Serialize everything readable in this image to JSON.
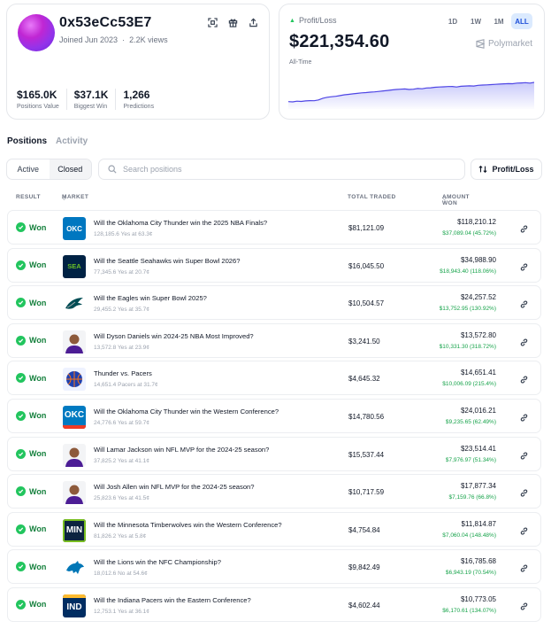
{
  "profile": {
    "username": "0x53eCc53E7",
    "joined": "Joined Jun 2023",
    "views": "2.2K views",
    "stats": [
      {
        "value": "$165.0K",
        "label": "Positions Value"
      },
      {
        "value": "$37.1K",
        "label": "Biggest Win"
      },
      {
        "value": "1,266",
        "label": "Predictions"
      }
    ]
  },
  "pnl": {
    "label": "Profit/Loss",
    "value": "$221,354.60",
    "period": "All-Time",
    "brand": "Polymarket",
    "ranges": [
      "1D",
      "1W",
      "1M",
      "ALL"
    ],
    "active_range": "ALL",
    "series": [
      0.5,
      0.45,
      0.6,
      0.55,
      0.65,
      0.7,
      0.68,
      0.85,
      1.2,
      1.4,
      1.5,
      1.6,
      1.75,
      1.9,
      2.0,
      2.1,
      2.2,
      2.3,
      2.35,
      2.45,
      2.5,
      2.6,
      2.7,
      2.8,
      2.9,
      3.0,
      3.05,
      3.1,
      3.0,
      3.05,
      3.2,
      3.15,
      3.3,
      3.35,
      3.45,
      3.5,
      3.55,
      3.6,
      3.62,
      3.5,
      3.65,
      3.7,
      3.75,
      3.7,
      3.85,
      3.9,
      3.95,
      4.0,
      4.05,
      4.1,
      4.15,
      4.2,
      4.18,
      4.3,
      4.35,
      4.4,
      4.3,
      4.45
    ]
  },
  "tabs": {
    "positions": "Positions",
    "activity": "Activity"
  },
  "filters": {
    "active": "Active",
    "closed": "Closed",
    "search_placeholder": "Search positions",
    "sort_label": "Profit/Loss"
  },
  "table": {
    "headers": {
      "result": "RESULT",
      "market": "MARKET",
      "total_traded": "TOTAL TRADED",
      "amount_won": "AMOUNT WON"
    },
    "rows": [
      {
        "result": "Won",
        "title": "Will the Oklahoma City Thunder win the 2025 NBA Finals?",
        "sub": "128,185.6 Yes at 63.3¢",
        "traded": "$81,121.09",
        "won": "$118,210.12",
        "pct": "$37,089.04 (45.72%)",
        "thumb": "okc-logo"
      },
      {
        "result": "Won",
        "title": "Will the Seattle Seahawks win Super Bowl 2026?",
        "sub": "77,345.6 Yes at 20.7¢",
        "traded": "$16,045.50",
        "won": "$34,988.90",
        "pct": "$18,943.40 (118.06%)",
        "thumb": "sea-logo"
      },
      {
        "result": "Won",
        "title": "Will the Eagles win Super Bowl 2025?",
        "sub": "29,455.2 Yes at 35.7¢",
        "traded": "$10,504.57",
        "won": "$24,257.52",
        "pct": "$13,752.95 (130.92%)",
        "thumb": "eagles-logo"
      },
      {
        "result": "Won",
        "title": "Will Dyson Daniels win 2024-25 NBA Most Improved?",
        "sub": "13,572.8 Yes at 23.9¢",
        "traded": "$3,241.50",
        "won": "$13,572.80",
        "pct": "$10,331.30 (318.72%)",
        "thumb": "player-photo"
      },
      {
        "result": "Won",
        "title": "Thunder vs. Pacers",
        "sub": "14,651.4 Pacers at 31.7¢",
        "traded": "$4,645.32",
        "won": "$14,651.41",
        "pct": "$10,006.09 (215.4%)",
        "thumb": "basketball-logo"
      },
      {
        "result": "Won",
        "title": "Will the Oklahoma City Thunder win the Western Conference?",
        "sub": "24,776.6 Yes at 59.7¢",
        "traded": "$14,780.56",
        "won": "$24,016.21",
        "pct": "$9,235.65 (62.49%)",
        "thumb": "okc-logo-large"
      },
      {
        "result": "Won",
        "title": "Will Lamar Jackson win NFL MVP for the 2024-25 season?",
        "sub": "37,825.2 Yes at 41.1¢",
        "traded": "$15,537.44",
        "won": "$23,514.41",
        "pct": "$7,976.97 (51.34%)",
        "thumb": "player-photo"
      },
      {
        "result": "Won",
        "title": "Will Josh Allen win NFL MVP for the 2024-25 season?",
        "sub": "25,823.6 Yes at 41.5¢",
        "traded": "$10,717.59",
        "won": "$17,877.34",
        "pct": "$7,159.76 (66.8%)",
        "thumb": "player-photo"
      },
      {
        "result": "Won",
        "title": "Will the Minnesota Timberwolves win the Western Conference?",
        "sub": "81,826.2 Yes at 5.8¢",
        "traded": "$4,754.84",
        "won": "$11,814.87",
        "pct": "$7,060.04 (148.48%)",
        "thumb": "min-logo"
      },
      {
        "result": "Won",
        "title": "Will the Lions win the NFC Championship?",
        "sub": "18,012.6 No at 54.6¢",
        "traded": "$9,842.49",
        "won": "$16,785.68",
        "pct": "$6,943.19 (70.54%)",
        "thumb": "lions-logo"
      },
      {
        "result": "Won",
        "title": "Will the Indiana Pacers win the Eastern Conference?",
        "sub": "12,753.1 Yes at 36.1¢",
        "traded": "$4,602.44",
        "won": "$10,773.05",
        "pct": "$6,170.61 (134.07%)",
        "thumb": "ind-logo"
      }
    ]
  },
  "thumb_text": {
    "okc": "OKC",
    "sea": "SEA",
    "min": "MIN",
    "ind": "IND"
  },
  "colors": {
    "accent": "#2563eb",
    "won": "#16a34a",
    "chart_line": "#4f46e5"
  }
}
